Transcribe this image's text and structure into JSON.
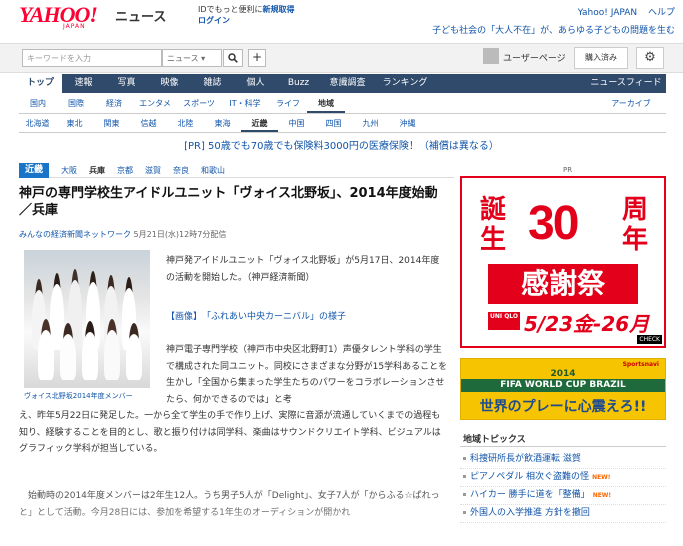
{
  "header": {
    "logo_text": "YAHOO!",
    "logo_sub": "JAPAN",
    "service": "ニュース",
    "id_text": "IDでもっと便利に",
    "register": "新規取得",
    "login": "ログイン",
    "link_yahoo": "Yahoo! JAPAN",
    "link_help": "ヘルプ",
    "topic_line": "子ども社会の「大人不在」が、あらゆる子どもの問題を生む"
  },
  "search": {
    "placeholder": "キーワードを入力",
    "scope": "ニュース",
    "scope_arrow": "▾",
    "search_icon": "search-icon",
    "plus": "+",
    "user_page": "ユーザーページ",
    "bought": "購入済み",
    "gear": "⚙"
  },
  "nav": {
    "tabs": [
      "トップ",
      "速報",
      "写真",
      "映像",
      "雑誌",
      "個人",
      "Buzz",
      "意識調査",
      "ランキング"
    ],
    "right": "ニュースフィード"
  },
  "nav2": {
    "tabs": [
      "国内",
      "国際",
      "経済",
      "エンタメ",
      "スポーツ",
      "IT・科学",
      "ライフ",
      "地域"
    ],
    "right": "アーカイブ"
  },
  "nav3": {
    "tabs": [
      "北海道",
      "東北",
      "関東",
      "信越",
      "北陸",
      "東海",
      "近畿",
      "中国",
      "四国",
      "九州",
      "沖縄"
    ]
  },
  "ad_line": "[PR] 50歳でも70歳でも保険料3000円の医療保険！（補償は異なる）",
  "region_tabs": {
    "current": "近畿",
    "items": [
      "大阪",
      "兵庫",
      "京都",
      "滋賀",
      "奈良",
      "和歌山"
    ]
  },
  "article": {
    "title": "神戸の専門学校生アイドルユニット「ヴォイス北野坂」、2014年度始動　／兵庫",
    "source": "みんなの経済新聞ネットワーク",
    "date": "5月21日(水)12時7分配信",
    "caption": "ヴォイス北野坂2014年度メンバー",
    "p1": "神戸発アイドルユニット「ヴォイス北野坂」が5月17日、2014年度の活動を開始した。（神戸経済新聞）",
    "image_link": "【画像】　「ふれあい中央カーニバル」の様子",
    "p2": "神戸電子専門学校（神戸市中央区北野町1）声優タレント学科の学生で構成された同ユニット。同校にさまざまな分野が15学科あることを生かし「全国から集まった学生たちのパワーをコラボレーションさせたら、何かできるのでは」と考",
    "p3": "え、昨年5月22日に発足した。一から全て学生の手で作り上げ、実際に音源が流通していくまでの過程も知り、経験することを目的とし、歌と振り付けは同学科、楽曲はサウンドクリエイト学科、ビジュアルはグラフィック学科が担当している。",
    "p4": "始動時の2014年度メンバーは2年生12人。うち男子5人が「Delight」、女子7人が「からふる☆ぱれっと」として活動。今月28日には、参加を希望する1年生のオーディションが開かれ"
  },
  "sidebar": {
    "pr": "PR",
    "uniqlo": {
      "left_top": "誕",
      "left_bottom": "生",
      "number": "30",
      "right_top": "周",
      "right_bottom": "年",
      "banner": "感謝祭",
      "logo": "UNI QLO",
      "dates": "5/23金-26月",
      "check": "CHECK"
    },
    "fifa": {
      "brand": "Sportsnavi",
      "year": "2014",
      "event": "FIFA WORLD CUP BRAZIL",
      "message": "世界のプレーに心震えろ!!"
    },
    "topics_title": "地域トピックス",
    "topics": [
      {
        "text": "科捜研所長が飲酒運転 滋賀",
        "new": ""
      },
      {
        "text": "ピアノペダル 相次ぐ盗難の怪",
        "new": "NEW!"
      },
      {
        "text": "ハイカー 勝手に道を「整備」",
        "new": "NEW!"
      },
      {
        "text": "外国人の入学推進 方針を撤回",
        "new": ""
      }
    ],
    "colors": {
      "accent": "#2f4a6b",
      "brand_red": "#e3001b",
      "link": "#1155aa"
    }
  }
}
